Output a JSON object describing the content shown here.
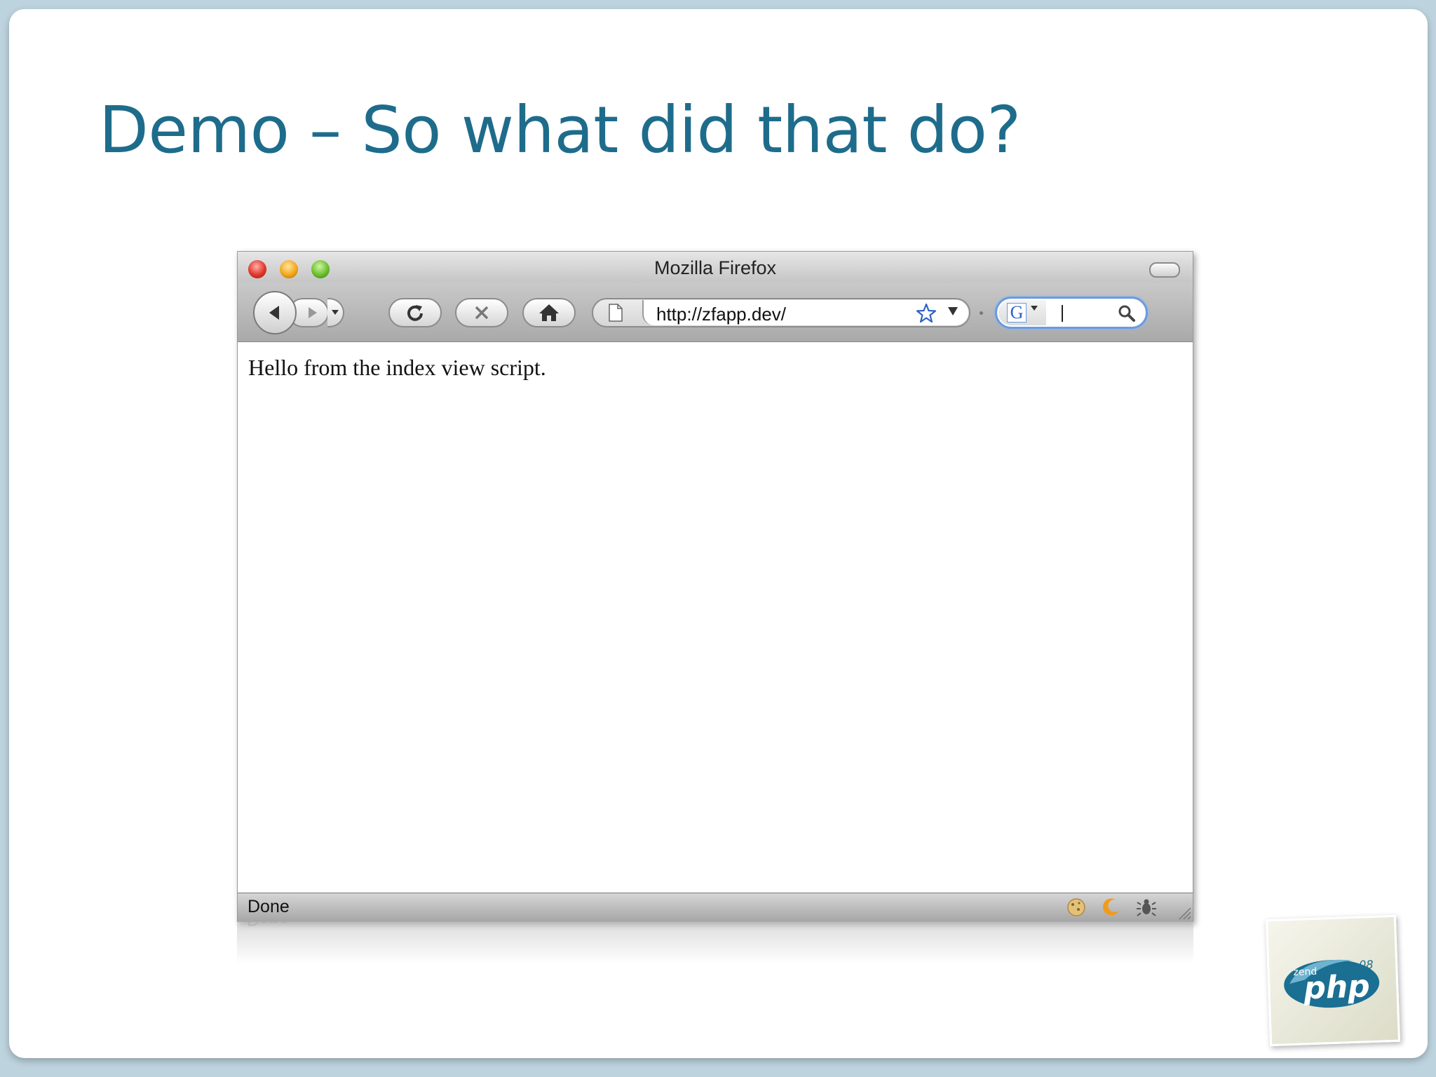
{
  "slide": {
    "title": "Demo – So what did that do?"
  },
  "window": {
    "title": "Mozilla Firefox"
  },
  "toolbar": {
    "url": "http://zfapp.dev/",
    "search_engine_letter": "G",
    "search_value": ""
  },
  "page": {
    "content_text": "Hello from the index view script."
  },
  "statusbar": {
    "status": "Done"
  },
  "logo": {
    "brand_small": "zend",
    "brand_main": "php",
    "brand_year": "08"
  },
  "icons": [
    "close-window-icon",
    "minimize-window-icon",
    "zoom-window-icon",
    "back-icon",
    "forward-icon",
    "reload-icon",
    "stop-icon",
    "home-icon",
    "page-icon",
    "bookmark-star-icon",
    "search-icon",
    "cookie-icon",
    "moon-icon",
    "bug-icon",
    "resize-grip-icon"
  ],
  "colors": {
    "title": "#1e6c8b",
    "slide_border": "#bdd3de",
    "search_focus": "#6a9be0"
  }
}
